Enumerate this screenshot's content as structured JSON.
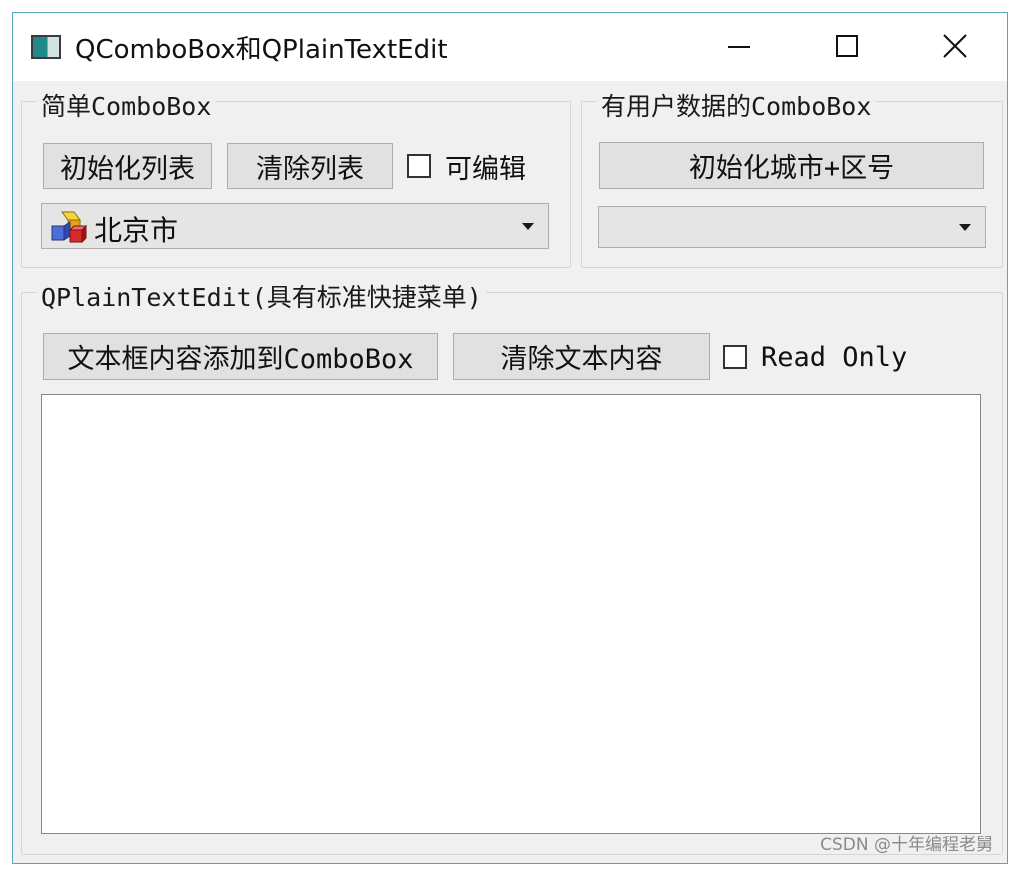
{
  "window": {
    "title": "QComboBox和QPlainTextEdit"
  },
  "simple_group": {
    "title": "简单ComboBox",
    "init_button": "初始化列表",
    "clear_button": "清除列表",
    "editable_checkbox": {
      "label": "可编辑",
      "checked": false
    },
    "combo": {
      "selected": "北京市",
      "icon": "colored-blocks-icon"
    }
  },
  "userdata_group": {
    "title": "有用户数据的ComboBox",
    "init_button": "初始化城市+区号",
    "combo": {
      "selected": ""
    }
  },
  "text_group": {
    "title": "QPlainTextEdit(具有标准快捷菜单)",
    "add_button": "文本框内容添加到ComboBox",
    "clear_button": "清除文本内容",
    "readonly_checkbox": {
      "label": "Read Only",
      "checked": false
    },
    "text_content": ""
  },
  "watermark": "CSDN @十年编程老舅",
  "colors": {
    "window_bg": "#f0f0f0",
    "button_bg": "#e1e1e1",
    "border_accent": "#5aa6b8"
  }
}
